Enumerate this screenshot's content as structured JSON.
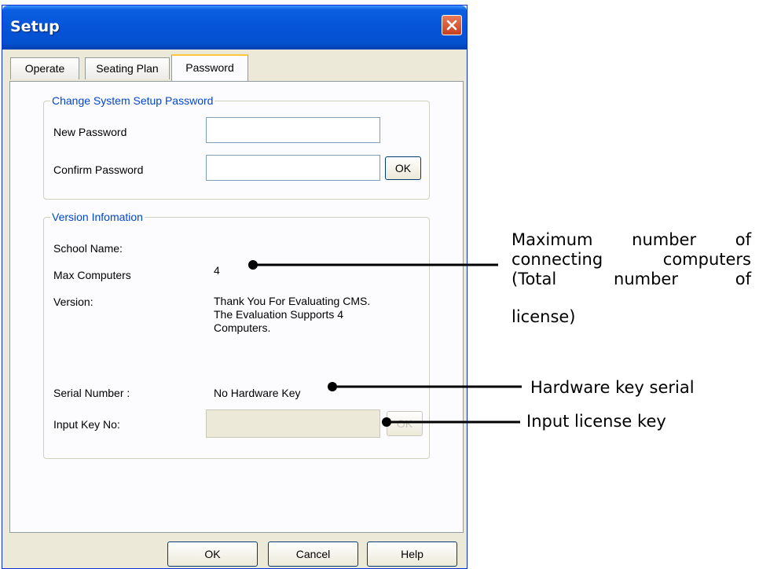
{
  "window": {
    "title": "Setup"
  },
  "tabs": [
    {
      "label": "Operate",
      "active": false
    },
    {
      "label": "Seating Plan",
      "active": false
    },
    {
      "label": "Password",
      "active": true
    }
  ],
  "password_group": {
    "title": "Change System Setup Password",
    "new_password_label": "New Password",
    "new_password_value": "",
    "confirm_password_label": "Confirm Password",
    "confirm_password_value": "",
    "ok_label": "OK"
  },
  "version_group": {
    "title": "Version Infomation",
    "school_name_label": "School Name:",
    "school_name_value": "",
    "max_computers_label": "Max Computers",
    "max_computers_value": "4",
    "version_label": "Version:",
    "version_lines": [
      "Thank You For Evaluating CMS.",
      "The Evaluation Supports 4",
      "Computers."
    ],
    "serial_label": "Serial Number :",
    "serial_value": "No Hardware Key",
    "input_key_label": "Input Key No:",
    "input_key_value": "",
    "input_key_ok_label": "OK"
  },
  "footer_buttons": {
    "ok": "OK",
    "cancel": "Cancel",
    "help": "Help"
  },
  "annotations": {
    "max_computers_lines": [
      "Maximum number of",
      "connecting computers",
      "(Total number of",
      "license)"
    ],
    "hardware_key": "Hardware key serial",
    "license_key": "Input license key"
  },
  "icons": {
    "close": "close-icon"
  },
  "colors": {
    "titlebar": "#0654d8",
    "close": "#c7401f",
    "group_title": "#0046d5",
    "active_tab_accent": "#ffc83c"
  }
}
